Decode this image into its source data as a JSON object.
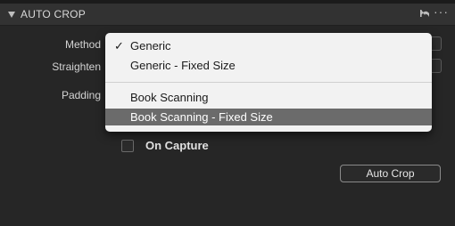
{
  "panel": {
    "title": "AUTO CROP",
    "reset_icon": "reset-arrow-icon",
    "more_icon": "more-dots-icon",
    "more_glyph": "···"
  },
  "fields": {
    "method_label": "Method",
    "straighten_label": "Straighten",
    "padding_label": "Padding"
  },
  "method_menu": {
    "selected": "Generic",
    "check_glyph": "✓",
    "items": [
      {
        "label": "Generic"
      },
      {
        "label": "Generic - Fixed Size"
      },
      {
        "label": "Book Scanning"
      },
      {
        "label": "Book Scanning - Fixed Size"
      }
    ],
    "highlighted": "Book Scanning - Fixed Size"
  },
  "on_capture": {
    "label": "On Capture",
    "checked": false
  },
  "actions": {
    "auto_crop_label": "Auto Crop"
  },
  "colors": {
    "panel_bg": "#262626",
    "header_bg": "#323232",
    "menu_bg": "#f2f2f2",
    "menu_highlight": "#6b6b6b"
  }
}
